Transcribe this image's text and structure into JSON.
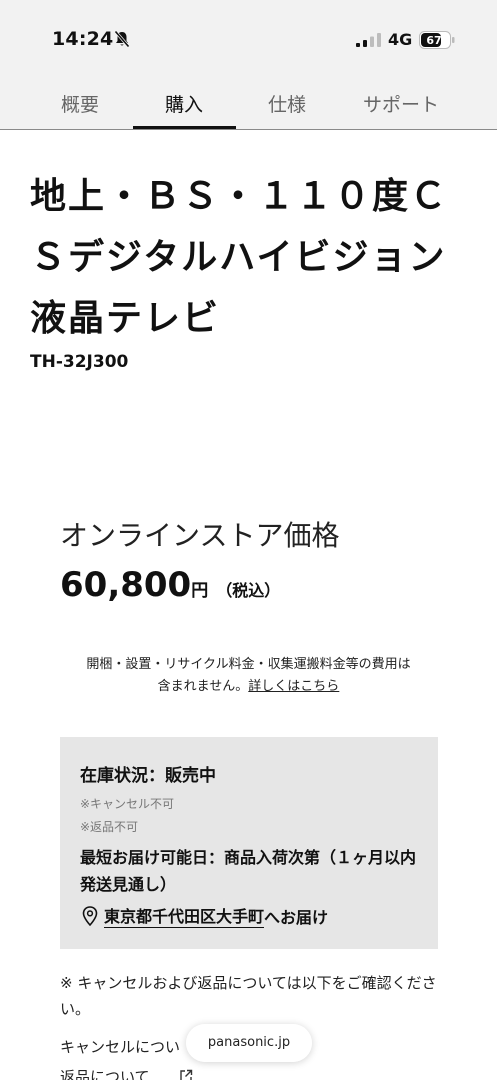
{
  "status_bar": {
    "time": "14:24",
    "network": "4G",
    "battery": "67",
    "icons": [
      "bell-muted-icon",
      "signal-icon",
      "battery-icon"
    ]
  },
  "tabs": [
    {
      "label": "概要",
      "active": false
    },
    {
      "label": "購入",
      "active": true
    },
    {
      "label": "仕様",
      "active": false
    },
    {
      "label": "サポート",
      "active": false
    }
  ],
  "product": {
    "title_lines": [
      "地上・ＢＳ・１１０度Ｃ",
      "Ｓデジタルハイビジョン",
      "液晶テレビ"
    ],
    "model": "TH-32J300"
  },
  "price": {
    "label": "オンラインストア価格",
    "value": "60,800",
    "unit": "円",
    "tax": "（税込）"
  },
  "fee_note": {
    "line1": "開梱・設置・リサイクル料金・収集運搬料金等の費用は",
    "line2_prefix": "含まれません。",
    "link": "詳しくはこちら"
  },
  "stock": {
    "status": "在庫状況：販売中",
    "note1": "※キャンセル不可",
    "note2": "※返品不可",
    "delivery": "最短お届け可能日：商品入荷次第（１ヶ月以内発送見通し）",
    "location_link": "東京都千代田区大手町",
    "location_suffix": "へお届け",
    "location_icon": "map-pin-icon"
  },
  "cancel_note": "※ キャンセルおよび返品については以下をご確認ください。",
  "cancel_line": "キャンセルについ",
  "return_line": "返品について",
  "url_pill": "panasonic.jp",
  "colors": {
    "chrome_bg": "#f2f2f2",
    "stock_box_bg": "#e6e6e6",
    "text": "#111111"
  }
}
